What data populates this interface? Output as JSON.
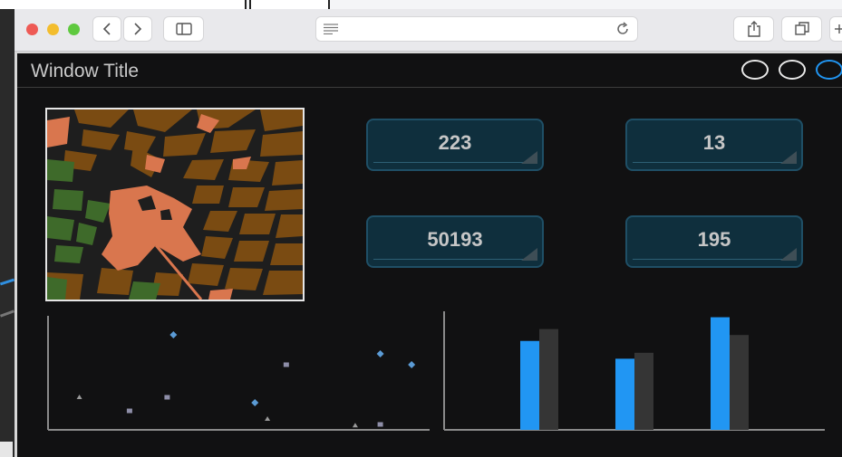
{
  "window": {
    "title": "Window Title"
  },
  "stats": [
    "223",
    "13",
    "50193",
    "195"
  ],
  "colors": {
    "accent": "#2196f3",
    "stat_bg": "#0f2f3d",
    "stat_border": "#1f4f66",
    "bar_secondary": "#353535",
    "map_building": "#7a4b12",
    "map_park": "#3e6a2a",
    "map_landmark": "#d9764e"
  },
  "icons": [
    "back-icon",
    "forward-icon",
    "sidebar-icon",
    "reader-icon",
    "reload-icon",
    "share-icon",
    "tabs-icon",
    "new-tab-icon"
  ],
  "chart_data": [
    {
      "type": "scatter",
      "series": [
        {
          "marker": "triangle",
          "points": [
            [
              0.5,
              0.6
            ],
            [
              3.5,
              0.2
            ],
            [
              4.9,
              0.08
            ]
          ]
        },
        {
          "marker": "square",
          "points": [
            [
              1.3,
              0.35
            ],
            [
              1.9,
              0.6
            ],
            [
              3.8,
              1.2
            ],
            [
              5.3,
              0.1
            ]
          ]
        },
        {
          "marker": "diamond",
          "points": [
            [
              2.0,
              1.75
            ],
            [
              3.3,
              0.5
            ],
            [
              5.3,
              1.4
            ],
            [
              5.8,
              1.2
            ]
          ]
        }
      ],
      "xlim": [
        0,
        6
      ],
      "ylim": [
        0,
        2
      ]
    },
    {
      "type": "bar",
      "categories": [
        "",
        "",
        ""
      ],
      "series": [
        {
          "color": "#2196f3",
          "values": [
            0.75,
            0.6,
            0.95
          ]
        },
        {
          "color": "#353535",
          "values": [
            0.85,
            0.65,
            0.8
          ]
        }
      ],
      "ylim": [
        0,
        1
      ]
    }
  ]
}
